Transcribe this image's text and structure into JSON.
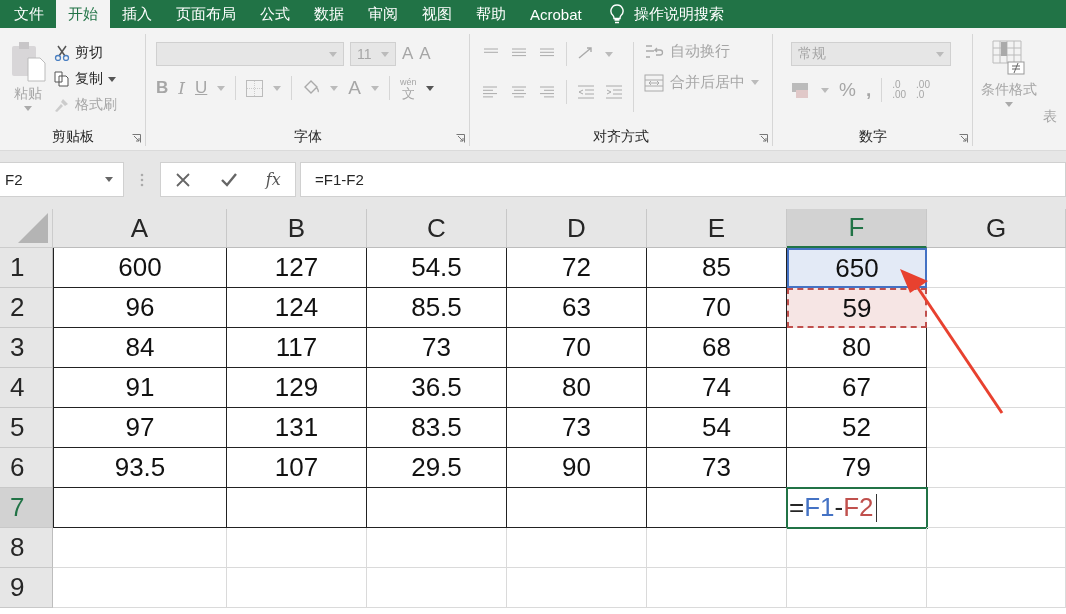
{
  "tabs": [
    {
      "label": "文件",
      "selected": false
    },
    {
      "label": "开始",
      "selected": true
    },
    {
      "label": "插入",
      "selected": false
    },
    {
      "label": "页面布局",
      "selected": false
    },
    {
      "label": "公式",
      "selected": false
    },
    {
      "label": "数据",
      "selected": false
    },
    {
      "label": "审阅",
      "selected": false
    },
    {
      "label": "视图",
      "selected": false
    },
    {
      "label": "帮助",
      "selected": false
    },
    {
      "label": "Acrobat",
      "selected": false
    }
  ],
  "tell_me": "操作说明搜索",
  "ribbon": [
    {
      "kind": "clipboard",
      "label": "剪贴板",
      "paste": {
        "label": "粘贴",
        "disabled": true
      },
      "cut": {
        "label": "剪切",
        "disabled": false
      },
      "copy": {
        "label": "复制",
        "disabled": false
      },
      "format_painter": {
        "label": "格式刷",
        "disabled": true
      }
    },
    {
      "kind": "font",
      "label": "字体",
      "disabled": true,
      "font_size": "11",
      "bold": "B",
      "italic": "I",
      "underline": "U",
      "grow": "A",
      "shrink": "A",
      "font_color": "A",
      "phonetic_top": "wén",
      "phonetic_bottom": "文"
    },
    {
      "kind": "alignment",
      "label": "对齐方式",
      "disabled": true,
      "wrap_text": "自动换行",
      "merge_center": "合并后居中"
    },
    {
      "kind": "number",
      "label": "数字",
      "disabled": true,
      "format": "常规",
      "percent": "%",
      "comma": ",",
      "increase_decimal": [
        ".0",
        ".00"
      ],
      "decrease_decimal": [
        ".00",
        ".0"
      ]
    },
    {
      "kind": "styles",
      "disabled": true,
      "conditional_formatting": "条件格式",
      "table_cut": "表"
    }
  ],
  "formula_bar": {
    "name_box": "F2",
    "fx": "fx",
    "formula": "=F1-F2"
  },
  "sheet": {
    "columns": [
      {
        "label": "A",
        "selected": false
      },
      {
        "label": "B",
        "selected": false
      },
      {
        "label": "C",
        "selected": false
      },
      {
        "label": "D",
        "selected": false
      },
      {
        "label": "E",
        "selected": false
      },
      {
        "label": "F",
        "selected": true
      },
      {
        "label": "G",
        "selected": false
      }
    ],
    "rows": [
      {
        "number": "1",
        "selected": false,
        "cells": [
          {
            "text": "600"
          },
          {
            "text": "127"
          },
          {
            "text": "54.5"
          },
          {
            "text": "72"
          },
          {
            "text": "85"
          },
          {
            "text": "650",
            "highlight": {
              "color": "#4472c4",
              "dashed": false
            }
          }
        ]
      },
      {
        "number": "2",
        "selected": false,
        "cells": [
          {
            "text": "96"
          },
          {
            "text": "124"
          },
          {
            "text": "85.5"
          },
          {
            "text": "63"
          },
          {
            "text": "70"
          },
          {
            "text": "59",
            "highlight": {
              "color": "#c0504d",
              "dashed": true
            }
          }
        ]
      },
      {
        "number": "3",
        "selected": false,
        "cells": [
          {
            "text": "84"
          },
          {
            "text": "117"
          },
          {
            "text": "73"
          },
          {
            "text": "70"
          },
          {
            "text": "68"
          },
          {
            "text": "80"
          }
        ]
      },
      {
        "number": "4",
        "selected": false,
        "cells": [
          {
            "text": "91"
          },
          {
            "text": "129"
          },
          {
            "text": "36.5"
          },
          {
            "text": "80"
          },
          {
            "text": "74"
          },
          {
            "text": "67"
          }
        ]
      },
      {
        "number": "5",
        "selected": false,
        "cells": [
          {
            "text": "97"
          },
          {
            "text": "131"
          },
          {
            "text": "83.5"
          },
          {
            "text": "73"
          },
          {
            "text": "54"
          },
          {
            "text": "52"
          }
        ]
      },
      {
        "number": "6",
        "selected": false,
        "cells": [
          {
            "text": "93.5"
          },
          {
            "text": "107"
          },
          {
            "text": "29.5"
          },
          {
            "text": "90"
          },
          {
            "text": "73"
          },
          {
            "text": "79"
          }
        ]
      },
      {
        "number": "7",
        "selected": true,
        "cells": [
          {
            "kind": "empty"
          },
          {
            "kind": "empty"
          },
          {
            "kind": "empty"
          },
          {
            "kind": "empty"
          },
          {
            "kind": "empty"
          },
          {
            "kind": "formula",
            "active": true,
            "tokens": [
              {
                "text": "=",
                "color": "#262626"
              },
              {
                "text": "F1",
                "color": "#4472c4"
              },
              {
                "text": "-",
                "color": "#262626"
              },
              {
                "text": "F2",
                "color": "#c0504d"
              }
            ]
          }
        ]
      },
      {
        "number": "8",
        "selected": false,
        "cells": []
      },
      {
        "number": "9",
        "selected": false,
        "cells": []
      }
    ],
    "annotation": {
      "kind": "arrow",
      "color": "#e8412f"
    }
  }
}
